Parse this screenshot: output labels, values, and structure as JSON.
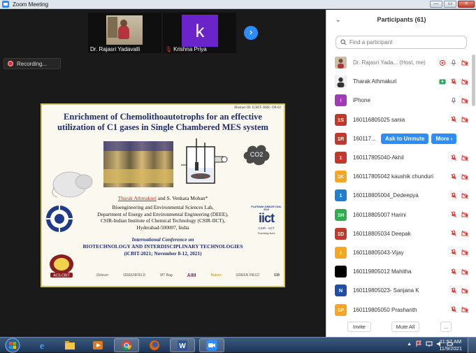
{
  "window": {
    "title": "Zoom Meeting"
  },
  "video_strip": [
    {
      "name": "Dr. Rajasri Yadavalli",
      "muted": false
    },
    {
      "name": "Krishna Priya",
      "avatar_letter": "k",
      "avatar_color": "#6a24c9",
      "muted": true
    }
  ],
  "recording": {
    "label": "Recording..."
  },
  "slide": {
    "abstract_id": "Abstract ID: ICBIT- BBE- OP-02",
    "title_line1": "Enrichment of Chemolithoautotrophs for an effective",
    "title_line2": "utilization of C1 gases in Single Chambered MES system",
    "co2_label": "CO2",
    "presenter": "Tharak Athmakuri",
    "coauthor": " and S. Venkata Mohan*",
    "affil_line1": "Bioengineering and Environmental Sciences Lab,",
    "affil_line2": "Department of Energy and Environmental Engineering (DEEE),",
    "affil_line3": "CSIR-Indian Institute of Chemical Technology (CSIR-IICT),",
    "affil_line4": "Hyderabad-500007, India",
    "conf_line1": "International Conference on",
    "conf_line2": "BIOTECHNOLOGY AND INTERDISCIPLINARY TECHNOLOGIES",
    "conf_line3": "(iCBIT-2021; November 8-12, 2021)",
    "iict_badge_top": "PLATINUM JUBILEE 1944-2019",
    "iict_logo": "iict",
    "iict_sub": "CSIR - IICT",
    "iict_tagline": "Touching lives",
    "acs_label": "ACS-CBIT",
    "sponsors": [
      "i2clever",
      "GREENFIELD",
      "MT Bag",
      "AIM",
      "Nature",
      "GREEN FIELD",
      "GM"
    ]
  },
  "participants": {
    "title": "Participants (61)",
    "search_placeholder": "Find a participant",
    "list": [
      {
        "initials": "",
        "color": "#8a7a66",
        "name": "Dr. Rajasri Yada... (Host, me)",
        "host": true,
        "cam": "on",
        "mic": "on"
      },
      {
        "initials": "",
        "color": "#3a3a3a",
        "name": "Tharak Athmakuri",
        "host": false,
        "cam": "share",
        "mic": "off"
      },
      {
        "initials": "I",
        "color": "#a23bb8",
        "name": "iPhone",
        "host": false,
        "cam": "off",
        "mic": "on"
      },
      {
        "initials": "1S",
        "color": "#c1392b",
        "name": "160116805025 sania",
        "host": false,
        "cam": "off",
        "mic": "off"
      },
      {
        "initials": "1R",
        "color": "#c1392b",
        "name": "160117...",
        "host": false,
        "hover": true
      },
      {
        "initials": "1",
        "color": "#c1392b",
        "name": "160117805040-Akhil",
        "host": false,
        "cam": "off",
        "mic": "off"
      },
      {
        "initials": "1K",
        "color": "#f5a623",
        "name": "160117805042 kaushik chunduri",
        "host": false,
        "cam": "off",
        "mic": "off"
      },
      {
        "initials": "1",
        "color": "#1f7fd1",
        "name": "160118805004_Dedeepya",
        "host": false,
        "cam": "off",
        "mic": "off"
      },
      {
        "initials": "1H",
        "color": "#2fae4e",
        "name": "160118805007 Harini",
        "host": false,
        "cam": "off",
        "mic": "off"
      },
      {
        "initials": "1D",
        "color": "#c1392b",
        "name": "160118805034 Deepak",
        "host": false,
        "cam": "off",
        "mic": "off"
      },
      {
        "initials": "1",
        "color": "#f5a623",
        "name": "160118805043-Vijay",
        "host": false,
        "cam": "off",
        "mic": "off"
      },
      {
        "initials": "",
        "color": "#000000",
        "name": "160119805012 Mahitha",
        "host": false,
        "cam": "off",
        "mic": "off"
      },
      {
        "initials": "N",
        "color": "#1f4fa8",
        "name": "160119805023- Sanjana K",
        "host": false,
        "cam": "off",
        "mic": "off"
      },
      {
        "initials": "1P",
        "color": "#f5a623",
        "name": "160119805050 Prashanth",
        "host": false,
        "cam": "off",
        "mic": "off"
      }
    ],
    "hover_buttons": {
      "unmute": "Ask to Unmute",
      "more": "More ›"
    },
    "footer": {
      "invite": "Invite",
      "mute_all": "Mute All",
      "more": "..."
    }
  },
  "taskbar": {
    "apps": [
      "windows-start",
      "internet-explorer",
      "file-explorer",
      "media-player",
      "chrome",
      "firefox",
      "word",
      "zoom"
    ],
    "clock_time": "11:57 AM",
    "clock_date": "11/9/2021"
  },
  "colors": {
    "zoom_blue": "#2d8cff",
    "muted_red": "#e0332d",
    "dark_bg": "#1a1a1a"
  }
}
